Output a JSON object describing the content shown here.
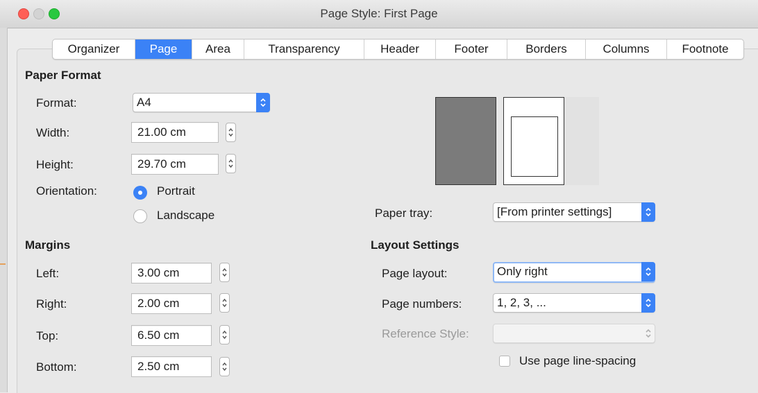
{
  "window": {
    "title": "Page Style: First Page"
  },
  "tabs": [
    {
      "label": "Organizer",
      "active": false
    },
    {
      "label": "Page",
      "active": true
    },
    {
      "label": "Area",
      "active": false
    },
    {
      "label": "Transparency",
      "active": false
    },
    {
      "label": "Header",
      "active": false
    },
    {
      "label": "Footer",
      "active": false
    },
    {
      "label": "Borders",
      "active": false
    },
    {
      "label": "Columns",
      "active": false
    },
    {
      "label": "Footnote",
      "active": false
    }
  ],
  "paper_format": {
    "heading": "Paper Format",
    "format_label": "Format:",
    "format_value": "A4",
    "width_label": "Width:",
    "width_value": "21.00 cm",
    "height_label": "Height:",
    "height_value": "29.70 cm",
    "orientation_label": "Orientation:",
    "portrait_label": "Portrait",
    "landscape_label": "Landscape",
    "orientation_selected": "Portrait"
  },
  "margins": {
    "heading": "Margins",
    "left_label": "Left:",
    "left_value": "3.00 cm",
    "right_label": "Right:",
    "right_value": "2.00 cm",
    "top_label": "Top:",
    "top_value": "6.50 cm",
    "bottom_label": "Bottom:",
    "bottom_value": "2.50 cm"
  },
  "paper_tray": {
    "label": "Paper tray:",
    "value": "[From printer settings]"
  },
  "layout_settings": {
    "heading": "Layout Settings",
    "page_layout_label": "Page layout:",
    "page_layout_value": "Only right",
    "page_numbers_label": "Page numbers:",
    "page_numbers_value": "1, 2, 3, ...",
    "reference_style_label": "Reference Style:",
    "reference_style_value": "",
    "line_spacing_label": "Use page line-spacing",
    "line_spacing_checked": false
  },
  "colors": {
    "accent": "#3b82f6",
    "close": "#ff5f57",
    "maximize": "#28c840",
    "preview_fill": "#7b7b7b"
  }
}
